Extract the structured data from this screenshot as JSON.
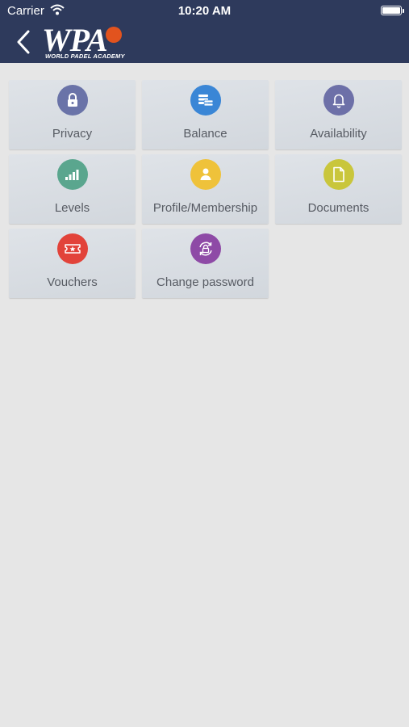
{
  "status_bar": {
    "carrier": "Carrier",
    "time": "10:20 AM"
  },
  "header": {
    "logo_text": "WPA",
    "logo_subtitle": "WORLD PADEL ACADEMY",
    "colors": {
      "background": "#2e3a5c",
      "logo_accent": "#e2531e"
    }
  },
  "tiles": [
    {
      "label": "Privacy",
      "icon": "lock-icon",
      "color": "#6a73a8"
    },
    {
      "label": "Balance",
      "icon": "coins-icon",
      "color": "#3a86d6"
    },
    {
      "label": "Availability",
      "icon": "bell-icon",
      "color": "#6d70a8"
    },
    {
      "label": "Levels",
      "icon": "signal-bars-icon",
      "color": "#5aa68e"
    },
    {
      "label": "Profile/Membership",
      "icon": "user-icon",
      "color": "#efc23a"
    },
    {
      "label": "Documents",
      "icon": "document-icon",
      "color": "#c9c63c"
    },
    {
      "label": "Vouchers",
      "icon": "ticket-icon",
      "color": "#e2433a"
    },
    {
      "label": "Change password",
      "icon": "refresh-lock-icon",
      "color": "#8e4aa6"
    }
  ]
}
